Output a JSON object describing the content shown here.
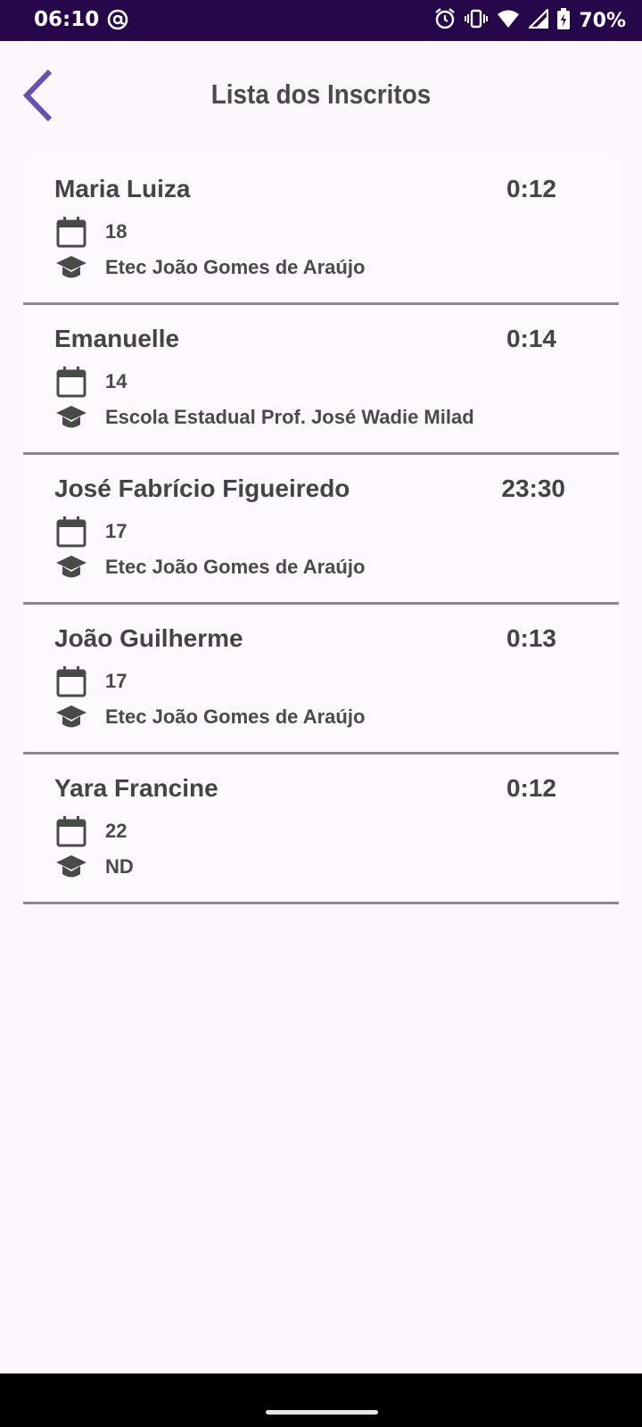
{
  "status_bar": {
    "time": "06:10",
    "battery": "70%",
    "icons": [
      "at-sign-icon",
      "alarm-icon",
      "vibrate-icon",
      "wifi-icon",
      "signal-icon",
      "battery-charging-icon"
    ]
  },
  "header": {
    "title": "Lista dos Inscritos",
    "back_icon": "chevron-left-icon"
  },
  "colors": {
    "status_bar": "#25074a",
    "accent": "#6a4fb0",
    "text": "#444444",
    "background": "#fcf7fd",
    "divider": "#8a8a8a"
  },
  "subscribers": [
    {
      "name": "Maria Luiza",
      "time": "0:12",
      "age": "18",
      "school": "Etec João Gomes de Araújo"
    },
    {
      "name": "Emanuelle",
      "time": "0:14",
      "age": "14",
      "school": "Escola Estadual Prof. José Wadie Milad"
    },
    {
      "name": "José Fabrício Figueiredo",
      "time": "23:30",
      "age": "17",
      "school": "Etec João Gomes de Araújo"
    },
    {
      "name": "João Guilherme",
      "time": "0:13",
      "age": "17",
      "school": "Etec João Gomes de Araújo"
    },
    {
      "name": "Yara Francine",
      "time": "0:12",
      "age": "22",
      "school": "ND"
    }
  ]
}
